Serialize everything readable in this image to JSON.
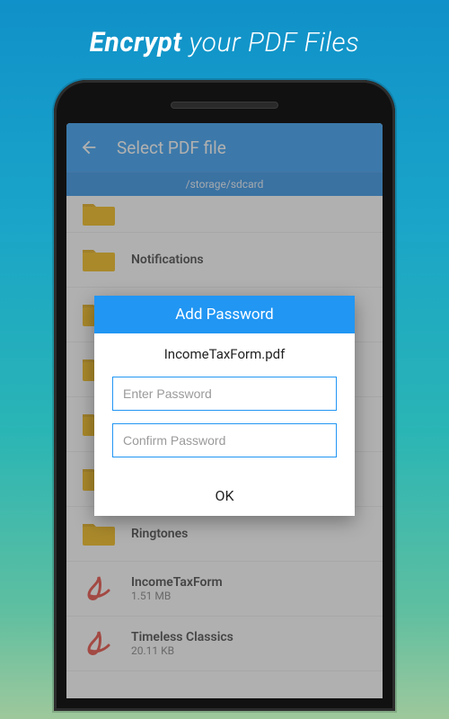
{
  "headline": {
    "bold": "Encrypt",
    "rest": " your PDF Files"
  },
  "appbar": {
    "title": "Select PDF file"
  },
  "pathbar": "/storage/sdcard",
  "folders": {
    "notifications": "Notifications",
    "ringtones": "Ringtones"
  },
  "files": {
    "income": {
      "name": "IncomeTaxForm",
      "size": "1.51 MB"
    },
    "timeless": {
      "name": "Timeless Classics",
      "size": "20.11 KB"
    }
  },
  "modal": {
    "title": "Add Password",
    "filename": "IncomeTaxForm.pdf",
    "ph_enter": "Enter Password",
    "ph_confirm": "Confirm Password",
    "ok": "OK"
  }
}
